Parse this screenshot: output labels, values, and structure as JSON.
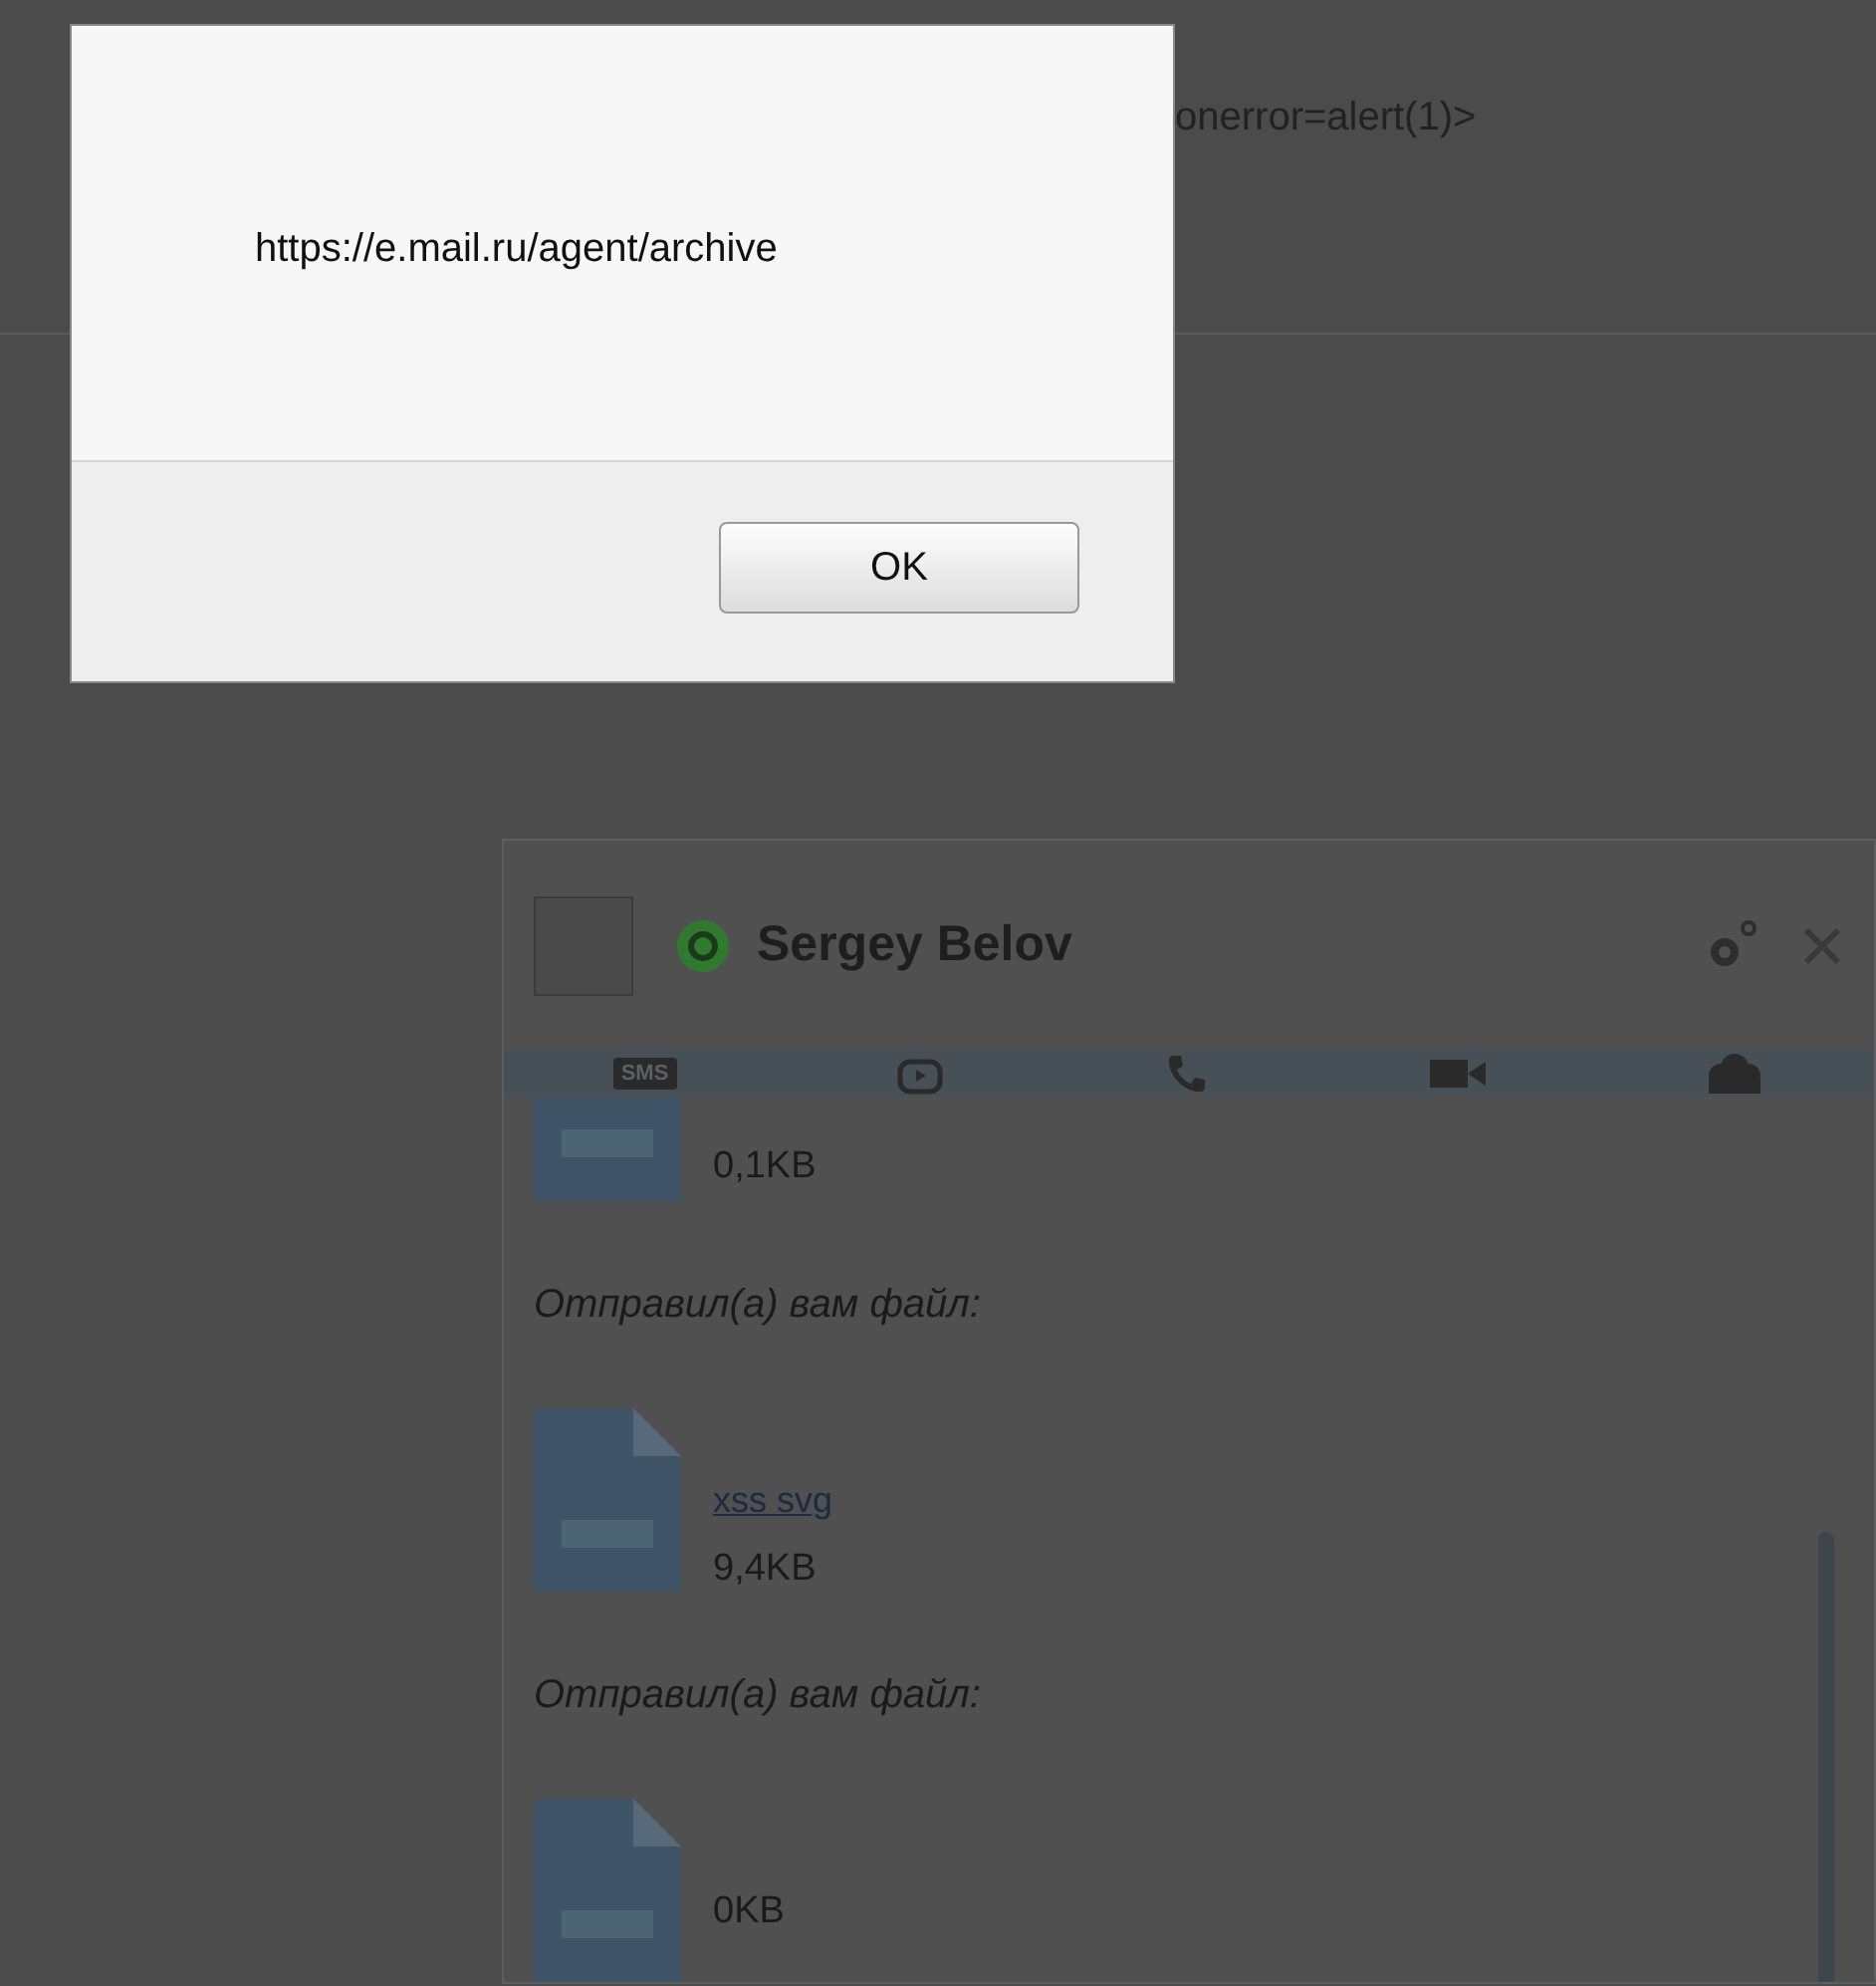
{
  "page": {
    "code_text": "onerror=alert(1)>"
  },
  "alert": {
    "message": "https://e.mail.ru/agent/archive",
    "button": "OK"
  },
  "chat": {
    "contact": "Sergey Belov",
    "toolbar": [
      {
        "kind": "sms",
        "label": "SMS"
      },
      {
        "kind": "game"
      },
      {
        "kind": "call"
      },
      {
        "kind": "video"
      },
      {
        "kind": "group"
      }
    ],
    "messages": [
      {
        "kind": "file",
        "size": "0,1KB"
      },
      {
        "kind": "notice",
        "text": "Отправил(а) вам файл:"
      },
      {
        "kind": "file",
        "name": "xss svg",
        "size": "9,4KB"
      },
      {
        "kind": "notice",
        "text": "Отправил(а) вам файл:"
      },
      {
        "kind": "file",
        "size": "0KB"
      }
    ]
  }
}
